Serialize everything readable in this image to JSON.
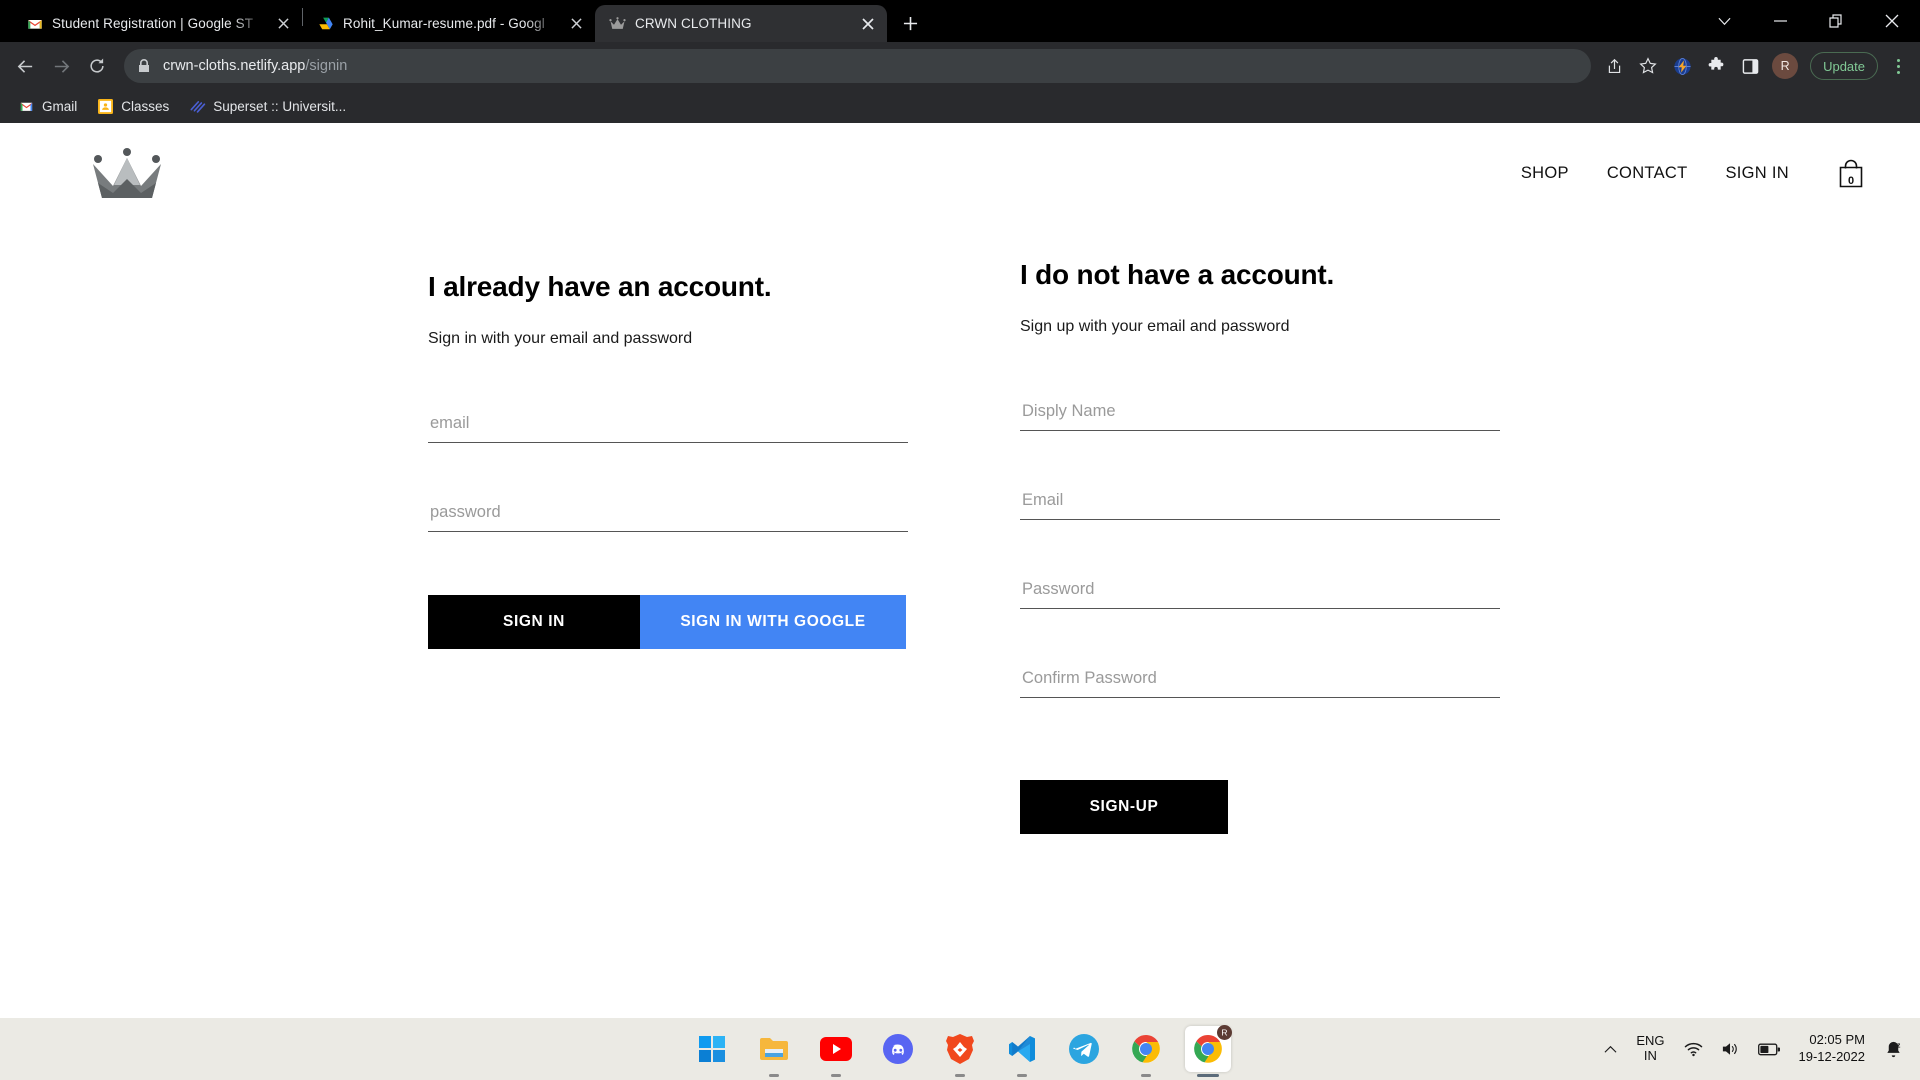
{
  "browser": {
    "tabs": [
      {
        "title": "Student Registration | Google ST",
        "favicon": "gmail-icon",
        "active": false
      },
      {
        "title": "Rohit_Kumar-resume.pdf - Googl",
        "favicon": "google-drive-icon",
        "active": false
      },
      {
        "title": "CRWN CLOTHING",
        "favicon": "crown-icon",
        "active": true
      }
    ],
    "new_tab_label": "+",
    "window_controls": {
      "tab_search": "tab-search-icon",
      "minimize": "minimize-icon",
      "maximize": "maximize-icon",
      "close": "close-icon"
    },
    "toolbar": {
      "back": "back-arrow-icon",
      "forward": "forward-arrow-icon",
      "reload": "reload-icon",
      "lock": "lock-icon",
      "url_domain": "crwn-cloths.netlify.app",
      "url_path": "/signin",
      "share": "share-icon",
      "bookmark": "star-icon",
      "extension_lightning": "lightning-globe-icon",
      "extensions": "puzzle-piece-icon",
      "side_panel": "side-panel-icon",
      "profile_initial": "R",
      "update_label": "Update",
      "menu": "kebab-menu-icon"
    },
    "bookmarks": [
      {
        "label": "Gmail",
        "icon": "gmail-icon"
      },
      {
        "label": "Classes",
        "icon": "google-classroom-icon"
      },
      {
        "label": "Superset :: Universit...",
        "icon": "superset-icon"
      }
    ]
  },
  "site": {
    "logo": "crown-logo-icon",
    "nav": [
      {
        "label": "SHOP"
      },
      {
        "label": "CONTACT"
      },
      {
        "label": "SIGN IN"
      }
    ],
    "cart": {
      "icon": "shopping-bag-icon",
      "count": "0"
    },
    "signin": {
      "title": "I already have an account.",
      "subtitle": "Sign in with your email and password",
      "fields": [
        {
          "name": "email",
          "placeholder": "email",
          "value": "",
          "type": "email"
        },
        {
          "name": "password",
          "placeholder": "password",
          "value": "",
          "type": "password"
        }
      ],
      "primary_button": "SIGN IN",
      "google_button": "SIGN IN WITH GOOGLE"
    },
    "signup": {
      "title": "I do not have a account.",
      "subtitle": "Sign up with your email and password",
      "fields": [
        {
          "name": "display-name",
          "placeholder": "Disply Name",
          "value": "",
          "type": "text"
        },
        {
          "name": "email",
          "placeholder": "Email",
          "value": "",
          "type": "email"
        },
        {
          "name": "password",
          "placeholder": "Password",
          "value": "",
          "type": "password"
        },
        {
          "name": "confirm-password",
          "placeholder": "Confirm Password",
          "value": "",
          "type": "password"
        }
      ],
      "primary_button": "SIGN-UP"
    }
  },
  "taskbar": {
    "apps": [
      {
        "name": "start-button",
        "icon": "windows-logo-icon",
        "running": false
      },
      {
        "name": "file-explorer",
        "icon": "folder-icon",
        "running": true
      },
      {
        "name": "youtube",
        "icon": "youtube-icon",
        "running": true
      },
      {
        "name": "discord",
        "icon": "discord-icon",
        "running": false
      },
      {
        "name": "brave-browser",
        "icon": "brave-lion-icon",
        "running": true
      },
      {
        "name": "vs-code",
        "icon": "vscode-icon",
        "running": true
      },
      {
        "name": "telegram",
        "icon": "telegram-icon",
        "running": false
      },
      {
        "name": "chrome-window-1",
        "icon": "chrome-icon",
        "running": true
      },
      {
        "name": "chrome-window-2",
        "icon": "chrome-icon",
        "running": true,
        "focused": true
      }
    ],
    "tray": {
      "overflow": "chevron-up-icon",
      "language_line1": "ENG",
      "language_line2": "IN",
      "wifi": "wifi-icon",
      "volume": "speaker-icon",
      "battery": "battery-icon",
      "time": "02:05 PM",
      "date": "19-12-2022",
      "notifications": "bell-do-not-disturb-icon"
    }
  },
  "colors": {
    "google_blue": "#4285f4",
    "button_black": "#000000",
    "tab_active": "#2f3033",
    "toolbar_bg": "#292a2d",
    "update_green": "#81c995"
  }
}
